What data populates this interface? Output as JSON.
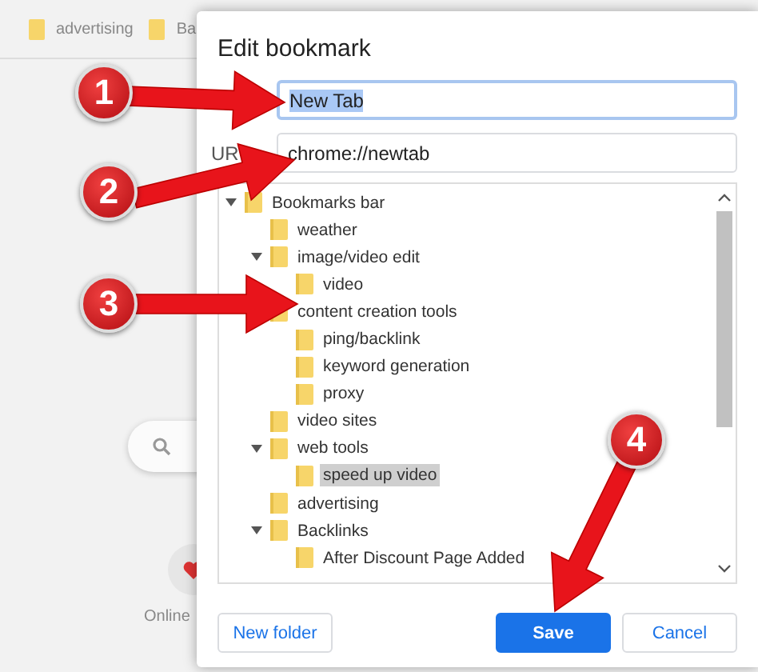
{
  "background": {
    "bookmarks": [
      {
        "label": "advertising"
      },
      {
        "label": "Ba"
      }
    ],
    "shortcut": {
      "label": "Online"
    }
  },
  "dialog": {
    "title": "Edit bookmark",
    "name": {
      "value": "New Tab",
      "text_selected": true
    },
    "url": {
      "label": "UR",
      "value": "chrome://newtab"
    },
    "tree": [
      {
        "label": "Bookmarks bar",
        "expanded": true,
        "selected": false,
        "children": [
          {
            "label": "weather",
            "selected": false
          },
          {
            "label": "image/video edit",
            "expanded": true,
            "selected": false,
            "children": [
              {
                "label": "video",
                "selected": false
              }
            ]
          },
          {
            "label": "content creation tools",
            "selected": false,
            "children": [
              {
                "label": "ping/backlink",
                "selected": false
              },
              {
                "label": "keyword generation",
                "selected": false
              },
              {
                "label": "proxy",
                "selected": false
              }
            ]
          },
          {
            "label": "video sites",
            "selected": false
          },
          {
            "label": "web tools",
            "expanded": true,
            "selected": false,
            "children": [
              {
                "label": "speed up video",
                "selected": true
              }
            ]
          },
          {
            "label": "advertising",
            "selected": false
          },
          {
            "label": "Backlinks",
            "expanded": true,
            "selected": false,
            "children": [
              {
                "label": "After Discount Page Added",
                "selected": false
              }
            ]
          }
        ]
      }
    ],
    "buttons": [
      {
        "label": "New folder",
        "kind": "secondary"
      },
      {
        "label": "Save",
        "kind": "primary"
      },
      {
        "label": "Cancel",
        "kind": "secondary"
      }
    ]
  },
  "callouts": [
    {
      "number": "1"
    },
    {
      "number": "2"
    },
    {
      "number": "3"
    },
    {
      "number": "4"
    }
  ]
}
